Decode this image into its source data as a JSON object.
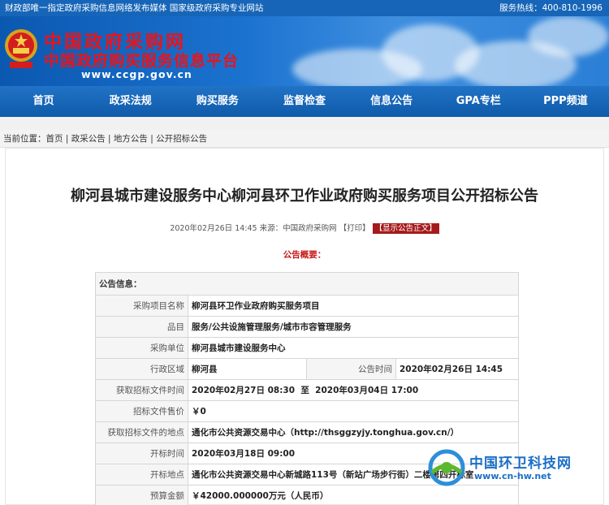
{
  "topbar": {
    "left": "财政部唯一指定政府采购信息网络发布媒体 国家级政府采购专业网站",
    "right": "服务热线：400-810-1996"
  },
  "banner": {
    "title": "中国政府采购网",
    "subtitle": "中国政府购买服务信息平台",
    "url": "www.ccgp.gov.cn"
  },
  "nav": {
    "items": [
      "首页",
      "政采法规",
      "购买服务",
      "监督检查",
      "信息公告",
      "GPA专栏",
      "PPP频道"
    ]
  },
  "breadcrumb": "当前位置：首页 | 政采公告 | 地方公告 | 公开招标公告",
  "article": {
    "title": "柳河县城市建设服务中心柳河县环卫作业政府购买服务项目公开招标公告",
    "meta_text": "2020年02月26日 14:45 来源：中国政府采购网 【打印】",
    "show_body_button": "【显示公告正文】",
    "summary_label": "公告概要："
  },
  "table": {
    "info_header": "公告信息：",
    "rows": {
      "project_name": {
        "label": "采购项目名称",
        "value": "柳河县环卫作业政府购买服务项目"
      },
      "category": {
        "label": "品目",
        "value": "服务/公共设施管理服务/城市市容管理服务"
      },
      "purchaser": {
        "label": "采购单位",
        "value": "柳河县城市建设服务中心"
      },
      "region": {
        "label": "行政区域",
        "value": "柳河县"
      },
      "publish_time": {
        "label": "公告时间",
        "value": "2020年02月26日 14:45"
      },
      "doc_time": {
        "label": "获取招标文件时间",
        "value": "2020年02月27日 08:30  至  2020年03月04日 17:00"
      },
      "doc_price": {
        "label": "招标文件售价",
        "value": "￥0"
      },
      "doc_place": {
        "label": "获取招标文件的地点",
        "value": "通化市公共资源交易中心（http://thsggzyjy.tonghua.gov.cn/）"
      },
      "open_time": {
        "label": "开标时间",
        "value": "2020年03月18日 09:00"
      },
      "open_place": {
        "label": "开标地点",
        "value": "通化市公共资源交易中心新城路113号（新站广场步行街）二楼第四开标室"
      },
      "budget": {
        "label": "预算金额",
        "value": "￥42000.000000万元（人民币）"
      }
    }
  },
  "watermark": {
    "name": "中国环卫科技网",
    "url": "www.cn-hw.net"
  },
  "colors": {
    "nav_blue": "#1665b8",
    "logo_red": "#e8141b",
    "summary_red": "#c71414",
    "watermark_blue": "#1c6fc6"
  }
}
